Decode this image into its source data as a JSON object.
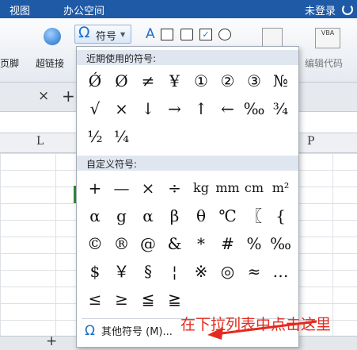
{
  "menubar": {
    "view": "视图",
    "office_space": "办公空间",
    "login": "未登录"
  },
  "ribbon": {
    "footer_label": "页脚",
    "hyperlink_label": "超链接",
    "symbol_label": "符号",
    "text_a": "A",
    "edit_code_label": "编辑代码",
    "vba_text": "VBA"
  },
  "tabs": {
    "close": "×",
    "add": "+"
  },
  "columns": {
    "L": "L",
    "P": "P"
  },
  "dropdown": {
    "recent_header": "近期使用的符号:",
    "recent": [
      "Ǿ",
      "Ø",
      "≠",
      "¥",
      "①",
      "②",
      "③",
      "№",
      "√",
      "×",
      "↓",
      "→",
      "↑",
      "←",
      "‰",
      "¾",
      "½",
      "¼"
    ],
    "custom_header": "自定义符号:",
    "custom": [
      "+",
      "—",
      "×",
      "÷",
      "kg",
      "mm",
      "cm",
      "m²",
      "α",
      "g",
      "α",
      "β",
      "θ",
      "℃",
      "〖",
      "{",
      "©",
      "®",
      "@",
      "&",
      "*",
      "#",
      "%",
      "‰",
      "$",
      "￥",
      "§",
      "¦",
      "※",
      "◎",
      "≈",
      "…",
      "≤",
      "≥",
      "≦",
      "≧"
    ],
    "other_label": "其他符号 (M)...",
    "other_icon": "omega-icon"
  },
  "sheetbar": {
    "add": "+"
  },
  "annotation": {
    "text": "在下拉列表中点击这里",
    "color": "#e32a1f"
  }
}
